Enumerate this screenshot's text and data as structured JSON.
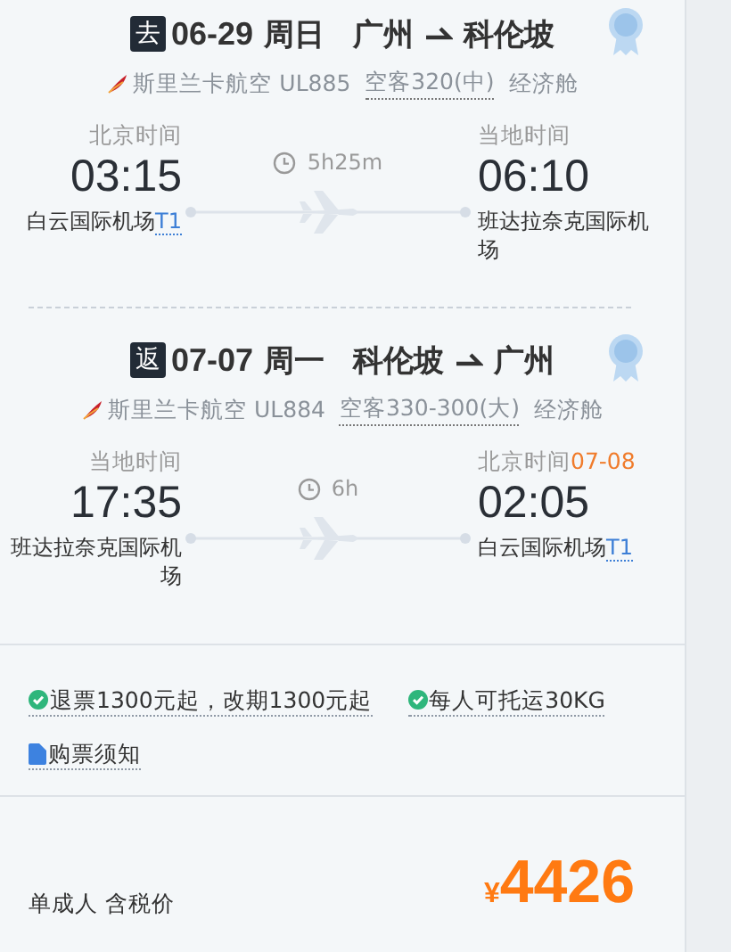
{
  "segments": [
    {
      "direction": "去",
      "date": "06-29",
      "weekday": "周日",
      "from": "广州",
      "to": "科伦坡",
      "airline": "斯里兰卡航空",
      "flight": "UL885",
      "aircraft": "空客320(中)",
      "cabin": "经济舱",
      "duration": "5h25m",
      "departure": {
        "time_label": "北京时间",
        "time": "03:15",
        "airport": "白云国际机场",
        "terminal": "T1"
      },
      "arrival": {
        "time_label": "当地时间",
        "time": "06:10",
        "airport": "班达拉奈克国际机场"
      }
    },
    {
      "direction": "返",
      "date": "07-07",
      "weekday": "周一",
      "from": "科伦坡",
      "to": "广州",
      "airline": "斯里兰卡航空",
      "flight": "UL884",
      "aircraft": "空客330-300(大)",
      "cabin": "经济舱",
      "duration": "6h",
      "departure": {
        "time_label": "当地时间",
        "time": "17:35",
        "airport": "班达拉奈克国际机场"
      },
      "arrival": {
        "time_label": "北京时间",
        "date_note": "07-08",
        "time": "02:05",
        "airport": "白云国际机场",
        "terminal": "T1"
      }
    }
  ],
  "policies": [
    {
      "kind": "check",
      "text": "退票1300元起，改期1300元起"
    },
    {
      "kind": "check",
      "text": "每人可托运30KG"
    },
    {
      "kind": "doc",
      "text": "购票须知"
    }
  ],
  "price": {
    "label": "单成人 含税价",
    "currency": "¥",
    "amount": "4426"
  }
}
